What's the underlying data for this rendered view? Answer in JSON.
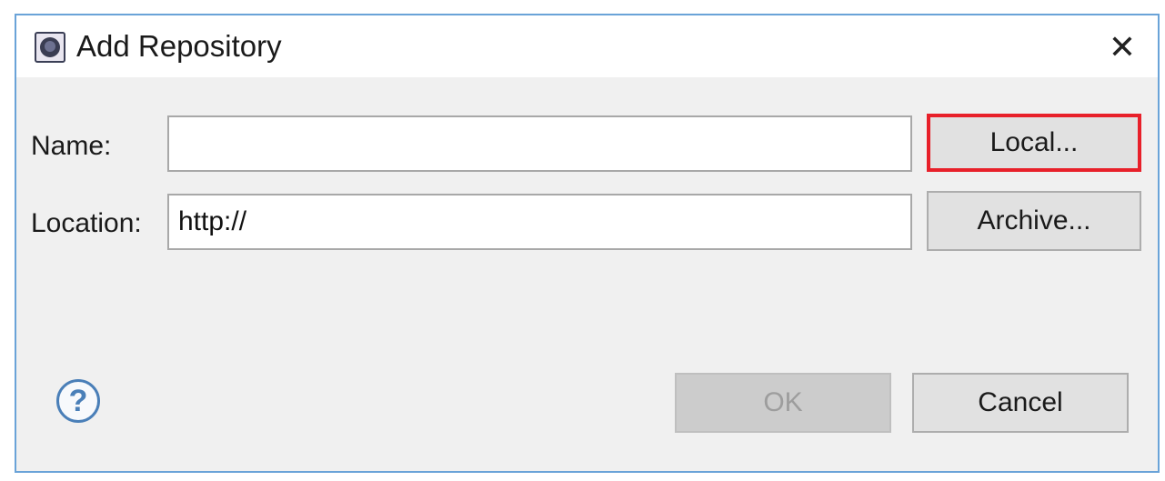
{
  "window": {
    "title": "Add Repository",
    "app_icon": "eclipse-icon",
    "close_glyph": "✕"
  },
  "form": {
    "name_label": "Name:",
    "name_value": "",
    "location_label": "Location:",
    "location_value": "http://"
  },
  "buttons": {
    "local": "Local...",
    "archive": "Archive...",
    "ok": "OK",
    "cancel": "Cancel"
  },
  "help": {
    "glyph": "?"
  },
  "colors": {
    "highlight_border": "#e8202a",
    "window_border": "#6aa3d8",
    "help_icon": "#4a7fb8"
  }
}
